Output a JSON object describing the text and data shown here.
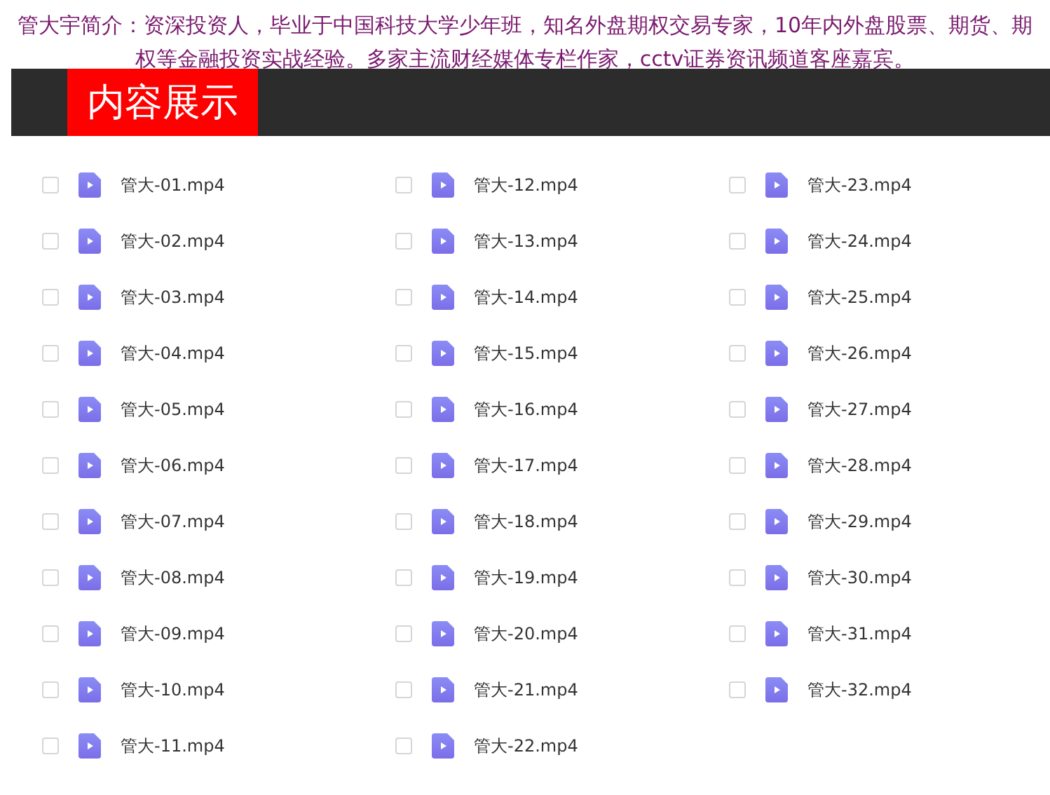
{
  "intro": "管大宇简介：资深投资人，毕业于中国科技大学少年班，知名外盘期权交易专家，10年内外盘股票、期货、期权等金融投资实战经验。多家主流财经媒体专栏作家，cctv证券资讯频道客座嘉宾。",
  "header": {
    "title": "内容展示"
  },
  "files": [
    {
      "name": "管大-01.mp4",
      "checked": false
    },
    {
      "name": "管大-02.mp4",
      "checked": false
    },
    {
      "name": "管大-03.mp4",
      "checked": false
    },
    {
      "name": "管大-04.mp4",
      "checked": false
    },
    {
      "name": "管大-05.mp4",
      "checked": false
    },
    {
      "name": "管大-06.mp4",
      "checked": false
    },
    {
      "name": "管大-07.mp4",
      "checked": false
    },
    {
      "name": "管大-08.mp4",
      "checked": false
    },
    {
      "name": "管大-09.mp4",
      "checked": false
    },
    {
      "name": "管大-10.mp4",
      "checked": false
    },
    {
      "name": "管大-11.mp4",
      "checked": false
    },
    {
      "name": "管大-12.mp4",
      "checked": false
    },
    {
      "name": "管大-13.mp4",
      "checked": false
    },
    {
      "name": "管大-14.mp4",
      "checked": false
    },
    {
      "name": "管大-15.mp4",
      "checked": false
    },
    {
      "name": "管大-16.mp4",
      "checked": false
    },
    {
      "name": "管大-17.mp4",
      "checked": false
    },
    {
      "name": "管大-18.mp4",
      "checked": false
    },
    {
      "name": "管大-19.mp4",
      "checked": false
    },
    {
      "name": "管大-20.mp4",
      "checked": false
    },
    {
      "name": "管大-21.mp4",
      "checked": false
    },
    {
      "name": "管大-22.mp4",
      "checked": false
    },
    {
      "name": "管大-23.mp4",
      "checked": false
    },
    {
      "name": "管大-24.mp4",
      "checked": false
    },
    {
      "name": "管大-25.mp4",
      "checked": false
    },
    {
      "name": "管大-26.mp4",
      "checked": false
    },
    {
      "name": "管大-27.mp4",
      "checked": false
    },
    {
      "name": "管大-28.mp4",
      "checked": false
    },
    {
      "name": "管大-29.mp4",
      "checked": false
    },
    {
      "name": "管大-30.mp4",
      "checked": false
    },
    {
      "name": "管大-31.mp4",
      "checked": false
    },
    {
      "name": "管大-32.mp4",
      "checked": false
    }
  ]
}
